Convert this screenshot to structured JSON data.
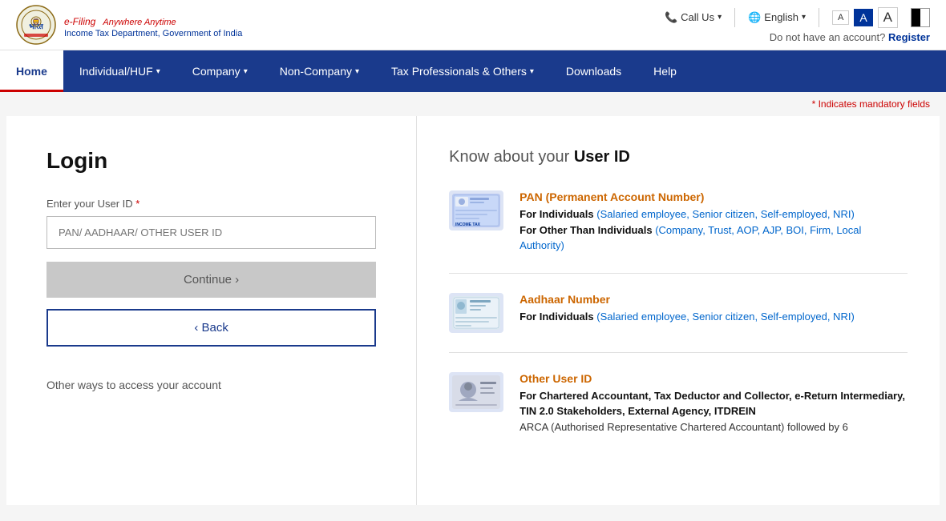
{
  "topbar": {
    "logo_efiling": "e-Filing",
    "logo_tagline": "Anywhere Anytime",
    "logo_subtitle": "Income Tax Department, Government of India",
    "call_us": "Call Us",
    "language": "English",
    "font_small": "A",
    "font_medium": "A",
    "font_large": "A",
    "no_account_text": "Do not have an account?",
    "register_label": "Register"
  },
  "navbar": {
    "items": [
      {
        "label": "Home",
        "active": true,
        "has_dropdown": false
      },
      {
        "label": "Individual/HUF",
        "active": false,
        "has_dropdown": true
      },
      {
        "label": "Company",
        "active": false,
        "has_dropdown": true
      },
      {
        "label": "Non-Company",
        "active": false,
        "has_dropdown": true
      },
      {
        "label": "Tax Professionals & Others",
        "active": false,
        "has_dropdown": true
      },
      {
        "label": "Downloads",
        "active": false,
        "has_dropdown": false
      },
      {
        "label": "Help",
        "active": false,
        "has_dropdown": false
      }
    ]
  },
  "mandatory_note": "* Indicates mandatory fields",
  "login": {
    "title": "Login",
    "user_id_label": "Enter your User ID",
    "user_id_placeholder": "PAN/ AADHAAR/ OTHER USER ID",
    "continue_btn": "Continue  ›",
    "back_btn": "‹ Back",
    "other_ways": "Other ways to access your account"
  },
  "userid_info": {
    "heading_prefix": "Know about your ",
    "heading_highlight": "User ID",
    "items": [
      {
        "id": "pan",
        "name_prefix": "PAN ",
        "name_detail": "(Permanent Account Number)",
        "desc_line1_prefix": "For Individuals",
        "desc_line1_detail": " (Salaried employee, Senior citizen, Self-employed, NRI)",
        "desc_line2_prefix": "For Other Than Individuals",
        "desc_line2_detail": " (Company, Trust, AOP, AJP, BOI, Firm, Local Authority)"
      },
      {
        "id": "aadhaar",
        "name_prefix": "Aadhaar Number",
        "name_detail": "",
        "desc_line1_prefix": "For Individuals",
        "desc_line1_detail": " (Salaried employee, Senior citizen, Self-employed, NRI)",
        "desc_line2_prefix": "",
        "desc_line2_detail": ""
      },
      {
        "id": "other",
        "name_prefix": "Other User ID",
        "name_detail": "",
        "desc_line1_prefix": "For Chartered Accountant, Tax Deductor and Collector, e-Return Intermediary, TIN 2.0 Stakeholders, External Agency, ITDREIN",
        "desc_line1_detail": "",
        "desc_line2_prefix": "ARCA (Authorised Representative Chartered Accountant) followed by 6",
        "desc_line2_detail": ""
      }
    ]
  }
}
